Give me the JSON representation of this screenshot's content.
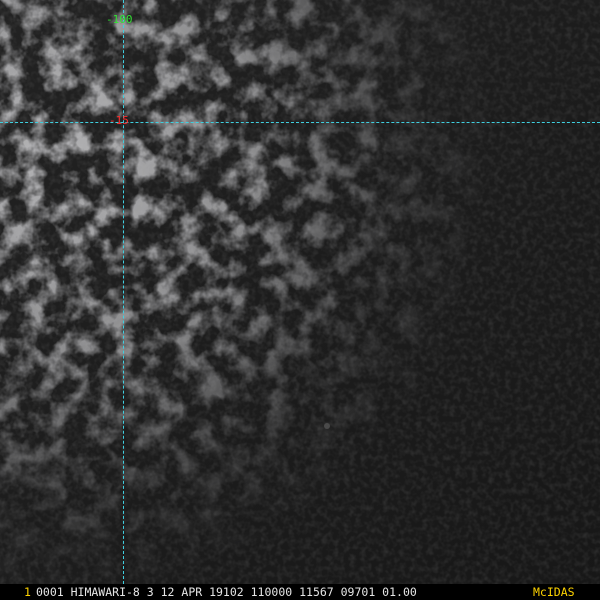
{
  "image": {
    "satellite": "HIMAWARI-8",
    "colors": {
      "background": "#1a1a1a",
      "cloud": "#9a9a9a",
      "grid_line": "#3fd0e0",
      "longitude_label": "#33e033",
      "latitude_label": "#ff2a2a",
      "status_text": "#e6e6e6",
      "accent": "#ffd400"
    }
  },
  "grid": {
    "longitude_label": "-100",
    "latitude_label": "-15"
  },
  "status_bar": {
    "frame_number": "1",
    "header": "0001 HIMAWARI-8  3 12 APR 19102 110000 11567 09701 01.00",
    "logo": "McIDAS"
  }
}
